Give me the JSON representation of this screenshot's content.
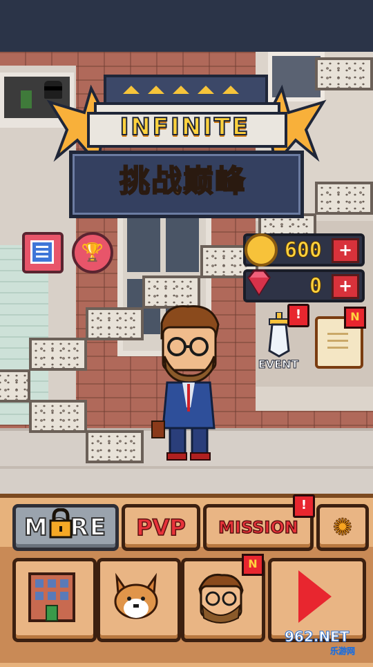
{
  "logo": {
    "title": "INFINITE",
    "subtitle": "挑战巅峰"
  },
  "side_buttons": [
    {
      "icon": "menu-list-icon"
    },
    {
      "icon": "trophy-icon"
    }
  ],
  "currency": {
    "coins": {
      "value": "600",
      "icon": "coin-icon",
      "add_label": "+"
    },
    "gems": {
      "value": "0",
      "icon": "gem-icon",
      "add_label": "+"
    }
  },
  "event": {
    "label": "EVENT",
    "alert": "!",
    "icon": "sword-icon"
  },
  "quest_scroll": {
    "icon": "scroll-icon",
    "badge": "N"
  },
  "mode_buttons": {
    "more": {
      "label": "MORE",
      "locked": true,
      "lock_icon": "padlock-icon"
    },
    "pvp": {
      "label": "PVP"
    },
    "mission": {
      "label": "MISSION",
      "alert": "!"
    },
    "settings": {
      "icon": "gear-icon",
      "glyph": "✺"
    }
  },
  "bottom_buttons": [
    {
      "name": "building",
      "icon": "building-icon"
    },
    {
      "name": "pet",
      "icon": "corgi-icon"
    },
    {
      "name": "character",
      "icon": "character-portrait-icon",
      "badge": "N"
    },
    {
      "name": "play",
      "icon": "play-icon"
    }
  ],
  "watermark": {
    "text": "962.NET",
    "sub": "乐游网"
  },
  "colors": {
    "accent_red": "#e8262f",
    "gold": "#ffd23e",
    "panel": "#e7b27c",
    "brick": "#b0695a"
  }
}
